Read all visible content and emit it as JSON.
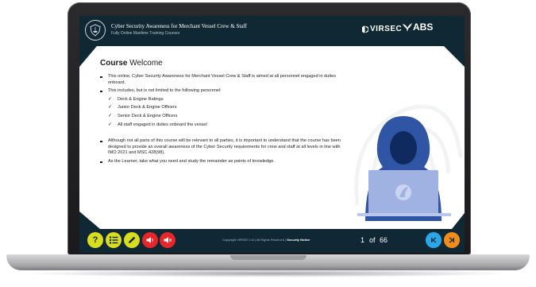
{
  "header": {
    "title": "Cyber Security Awareness for Merchant Vessel Crew & Staff",
    "subtitle": "Fully Online Maritime Training Courses",
    "logo_virsec": "VIRSEC",
    "logo_abs": "ABS"
  },
  "content": {
    "heading_bold": "Course",
    "heading_rest": " Welcome",
    "bullet_1": "This online, Cyber Security Awareness for Merchant Vessel Crew & Staff is aimed at all personnel engaged in duties onboard.",
    "bullet_2": "This includes, but is not limited to the following personnel:",
    "sub_items": [
      "Deck & Engine Ratings",
      "Junior Deck & Engine Officers",
      "Senior Deck & Engine Officers",
      "All staff engaged in duties onboard the vessel"
    ],
    "check_glyph": "✓",
    "bullet_3": "Although not all parts of this course will be relevant to all parties, it is important to understand that the course has been designed to provide an overall awareness of the Cyber Security requirements for crew and staff at all levels in line with IMO 2021 and MSC.428(98).",
    "bullet_4": "As the Learner, take what you need and study the remainder as points of knowledge."
  },
  "footer": {
    "help_label": "?",
    "copyright": "Copyright VIRSEC Ltd  |  All Rights Reserved  |",
    "security_notice": "Security Notice",
    "page_current": "1",
    "page_of": "of",
    "page_total": "66"
  },
  "colors": {
    "navy": "#0f2833",
    "yellow": "#d8dd1f",
    "red": "#e5262a",
    "blue": "#2aa7e8",
    "orange": "#f28c1a",
    "hacker_blue": "#2f55a4",
    "laptop_light": "#9fb2e2"
  },
  "icons": [
    "shield-crest-icon",
    "virsec-mark-icon",
    "eagle-icon",
    "help-icon",
    "menu-list-icon",
    "pencil-icon",
    "volume-icon",
    "mute-icon",
    "first-page-icon",
    "next-page-icon",
    "hacker-illustration"
  ]
}
